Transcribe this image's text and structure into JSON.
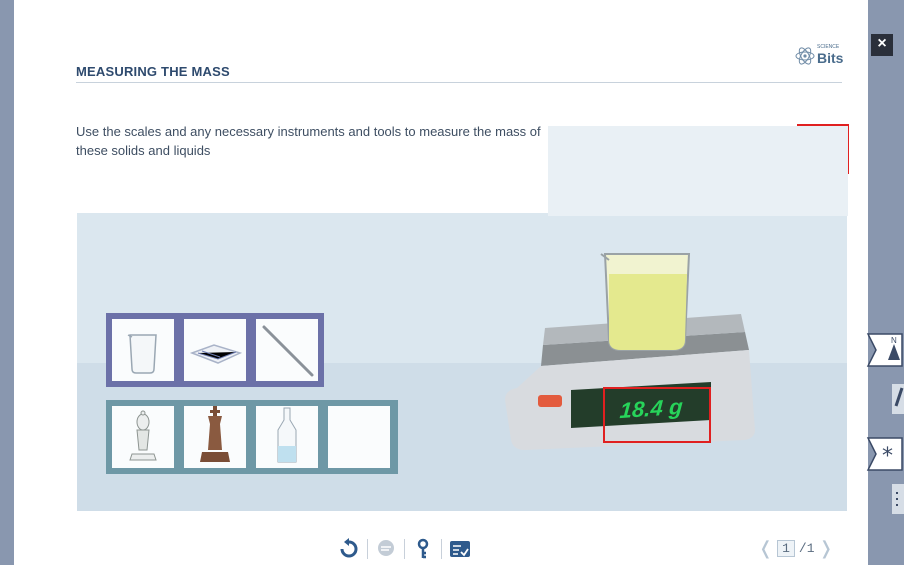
{
  "window": {
    "close_label": "×"
  },
  "header": {
    "title": "MEASURING THE MASS",
    "logo_top": "SCIENCE",
    "logo_name": "Bits"
  },
  "activity": {
    "instructions": "Use the scales and any necessary instruments and tools to measure the mass of these solids and liquids"
  },
  "tools": {
    "edit_icon": "pencil-icon",
    "tray_tools": [
      "beaker-icon",
      "cloth-icon",
      "glass-rod-icon"
    ],
    "tray_objects": [
      "white-bishop-icon",
      "brown-king-icon",
      "water-bottle-icon",
      "empty-slot"
    ]
  },
  "scale": {
    "reading": "18.4 g"
  },
  "bottom_toolbar": {
    "buttons": [
      "reset-icon",
      "chat-icon",
      "hint-icon",
      "checklist-icon"
    ]
  },
  "pager": {
    "current": "1",
    "total": "/1",
    "prev_arrow": "❬",
    "next_arrow": "❭"
  },
  "side_tools": [
    "compass-icon",
    "pencil-icon",
    "star-icon",
    "menu-icon"
  ],
  "colors": {
    "highlight": "#e02020",
    "title": "#2e4a6e",
    "display": "#27d45a"
  }
}
